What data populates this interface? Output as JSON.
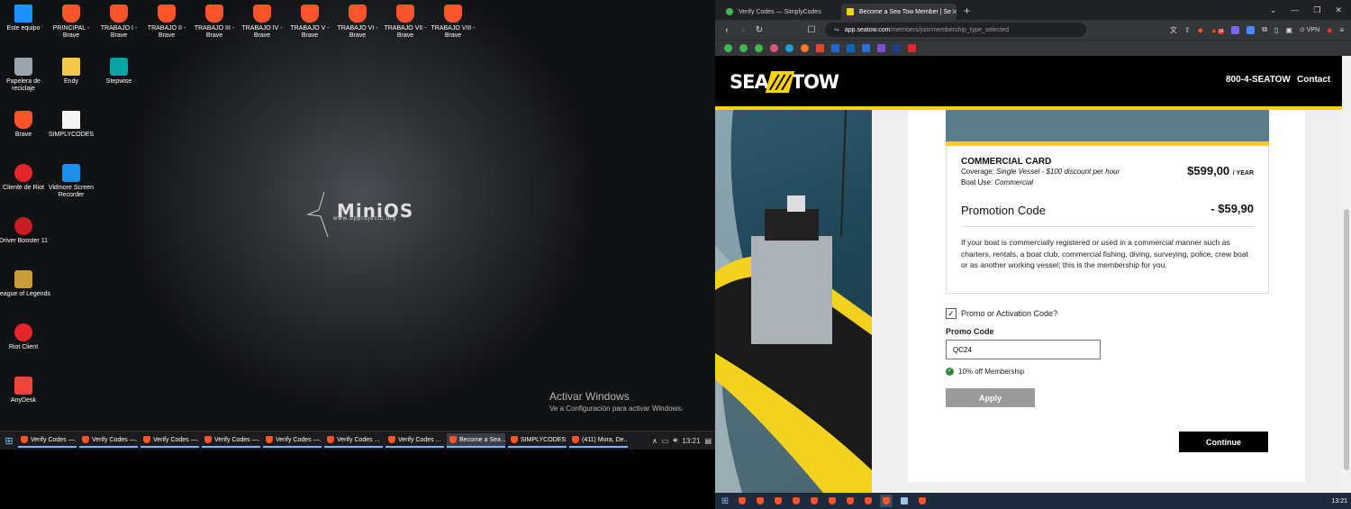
{
  "desktop": {
    "icons": [
      {
        "label": "Este equipo",
        "icon": "pc-icon"
      },
      {
        "label": "PRINCIPAL - Brave",
        "icon": "brave-icon"
      },
      {
        "label": "TRABAJO I - Brave",
        "icon": "brave-icon"
      },
      {
        "label": "TRABAJO II - Brave",
        "icon": "brave-icon"
      },
      {
        "label": "TRABAJO III - Brave",
        "icon": "brave-icon"
      },
      {
        "label": "TRABAJO IV - Brave",
        "icon": "brave-icon"
      },
      {
        "label": "TRABAJO V - Brave",
        "icon": "brave-icon"
      },
      {
        "label": "TRABAJO VI - Brave",
        "icon": "brave-icon"
      },
      {
        "label": "TRABAJO VII - Brave",
        "icon": "brave-icon"
      },
      {
        "label": "TRABAJO VIII - Brave",
        "icon": "brave-icon"
      },
      {
        "label": "Papelera de reciclaje",
        "icon": "recycle-bin-icon"
      },
      {
        "label": "Endy",
        "icon": "folder-icon"
      },
      {
        "label": "Stepwise",
        "icon": "stepwise-icon"
      },
      {
        "label": "Brave",
        "icon": "brave-icon"
      },
      {
        "label": "SIMPLYCODES",
        "icon": "text-file-icon"
      },
      {
        "label": "Cliente de Riot",
        "icon": "riot-icon"
      },
      {
        "label": "Vidmore Screen Recorder",
        "icon": "screen-recorder-icon"
      },
      {
        "label": "Driver Booster 11",
        "icon": "driver-booster-icon"
      },
      {
        "label": "League of Legends",
        "icon": "league-icon"
      },
      {
        "label": "Riot Client",
        "icon": "riot-icon"
      },
      {
        "label": "AnyDesk",
        "icon": "anydesk-icon"
      }
    ],
    "wallpaper": {
      "logo": "MiniOS",
      "url": "www.opprojects.org"
    },
    "activation": {
      "title": "Activar Windows",
      "subtitle": "Ve a Configuración para activar Windows."
    }
  },
  "taskbar_left": {
    "buttons": [
      "Verify Codes —...",
      "Verify Codes —...",
      "Verify Codes —...",
      "Verify Codes —...",
      "Verify Codes —...",
      "Verify Codes ...",
      "Verify Codes ...",
      "Become a Sea ...",
      "SIMPLYCODES:...",
      "(411) Mora, De..."
    ],
    "active_index": 7,
    "clock": "13:21"
  },
  "taskbar_right": {
    "clock": "13:21"
  },
  "browser": {
    "tabs": [
      {
        "title": "Verify Codes — SimplyCodes",
        "favicon_color": "#3dba4e"
      },
      {
        "title": "Become a Sea Tow Member | Se",
        "favicon_color": "#ffd200"
      }
    ],
    "active_tab": 1,
    "url_host": "app.seatow.com",
    "url_path": "/members/join/membership_type_selected",
    "vpn_label": "VPN",
    "brave_badge": "14"
  },
  "site": {
    "logo_left": "SEA",
    "logo_right": "TOW",
    "phone": "800-4-SEATOW",
    "contact": "Contact",
    "card": {
      "title": "COMMERCIAL CARD",
      "coverage_label": "Coverage:",
      "coverage_value": "Single Vessel - $100 discount per hour",
      "boat_use_label": "Boat Use:",
      "boat_use_value": "Commercial",
      "price": "$599,00",
      "price_unit": "/ YEAR",
      "promo_label": "Promotion Code",
      "promo_amount": "- $59,90",
      "description": "If your boat is commercially registered or used in a commercial manner such as charters, rentals, a boat club, commercial fishing, diving, surveying, police, crew boat or as another working vessel; this is the membership for you."
    },
    "promo_checkbox_label": "Promo or Activation Code?",
    "promo_checked": true,
    "promo_code_label": "Promo Code",
    "promo_code_value": "QC24",
    "success_text": "10% off Membership",
    "apply_label": "Apply",
    "continue_label": "Continue"
  },
  "colors": {
    "brand_yellow": "#ffd200",
    "header_black": "#000000",
    "success_green": "#2e8b3e",
    "apply_gray": "#9b9b9b"
  }
}
